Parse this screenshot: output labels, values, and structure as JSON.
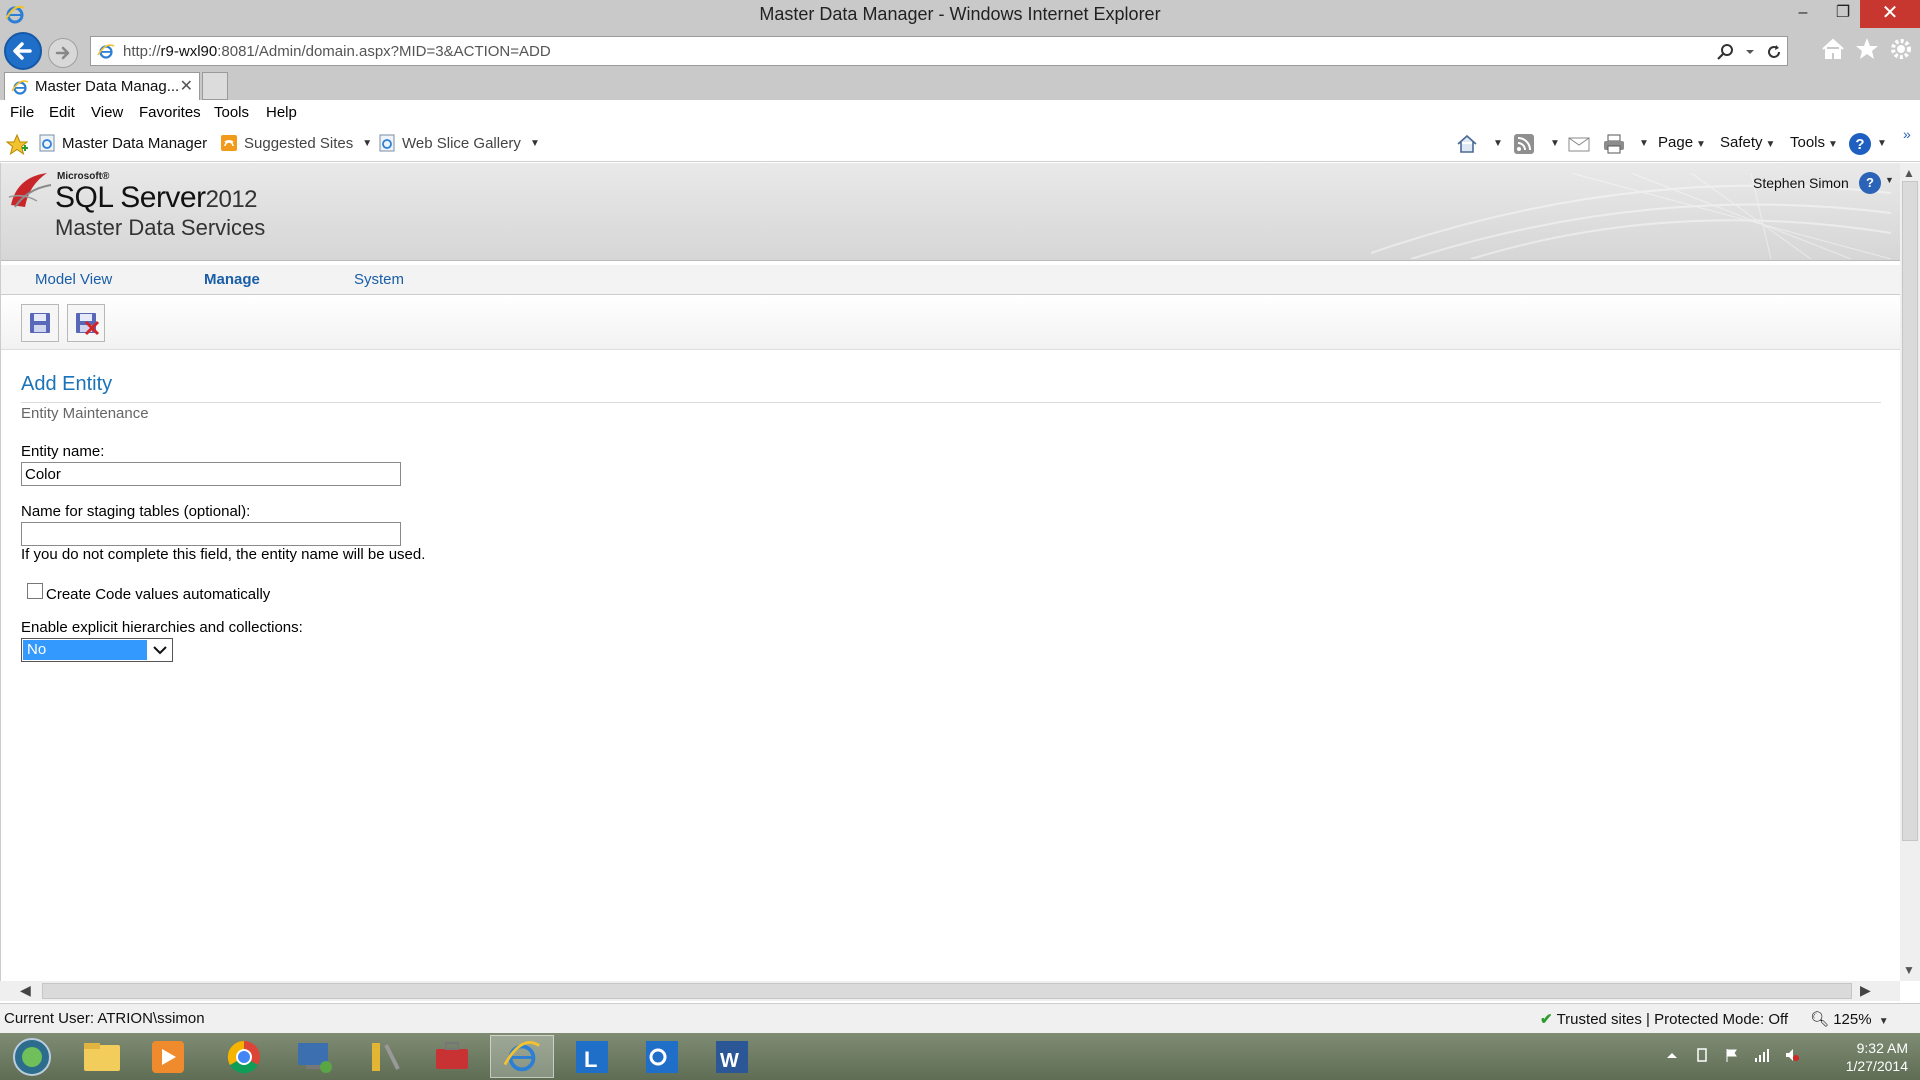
{
  "window": {
    "title": "Master Data Manager - Windows Internet Explorer",
    "minimize": "–",
    "maximize": "❐",
    "close": "✕"
  },
  "address": {
    "url_prefix": "http://",
    "url_host": "r9-wxl90",
    "url_rest": ":8081/Admin/domain.aspx?MID=3&ACTION=ADD"
  },
  "tab": {
    "label": "Master Data Manag...",
    "close": "✕"
  },
  "menu": [
    "File",
    "Edit",
    "View",
    "Favorites",
    "Tools",
    "Help"
  ],
  "favorites": {
    "items": [
      {
        "label": "Master Data Manager"
      },
      {
        "label": "Suggested Sites"
      },
      {
        "label": "Web Slice Gallery"
      }
    ],
    "commands": [
      "Page",
      "Safety",
      "Tools"
    ]
  },
  "app": {
    "brand_ms": "Microsoft®",
    "brand_product": "SQL Server",
    "brand_version": "2012",
    "brand_subtitle": "Master Data Services",
    "user": "Stephen Simon",
    "help": "?"
  },
  "nav": {
    "tabs": [
      {
        "label": "Model View",
        "active": false
      },
      {
        "label": "Manage",
        "active": true
      },
      {
        "label": "System",
        "active": false
      }
    ]
  },
  "toolbar": {
    "save_icon": "save-icon",
    "cancel_icon": "cancel-save-icon"
  },
  "form": {
    "title": "Add Entity",
    "subtitle": "Entity Maintenance",
    "entity_name_label": "Entity name:",
    "entity_name_value": "Color",
    "staging_label": "Name for staging tables (optional):",
    "staging_value": "",
    "staging_hint": "If you do not complete this field, the entity name will be used.",
    "create_code_label": "Create Code values automatically",
    "create_code_checked": false,
    "hierarchies_label": "Enable explicit hierarchies and collections:",
    "hierarchies_value": "No"
  },
  "status": {
    "current_user": "Current User: ATRION\\ssimon",
    "zone": "Trusted sites | Protected Mode: Off",
    "zoom": "125%"
  },
  "taskbar": {
    "time": "9:32 AM",
    "date": "1/27/2014"
  },
  "colors": {
    "link_blue": "#1a5ea8",
    "heading_blue": "#1a72b8",
    "select_highlight": "#3399ff",
    "close_red": "#c7372f"
  }
}
